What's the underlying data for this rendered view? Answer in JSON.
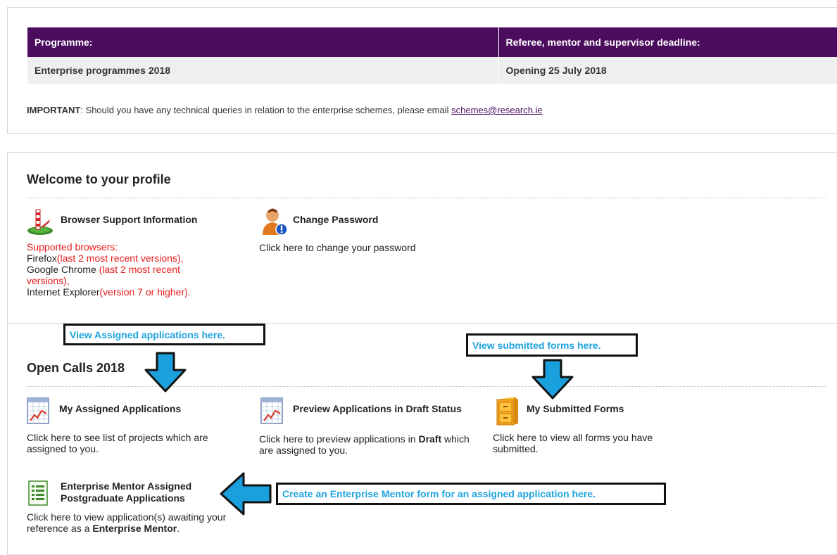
{
  "table": {
    "header_programme": "Programme:",
    "header_deadline": "Referee, mentor and supervisor deadline:",
    "row_programme": "Enterprise programmes 2018",
    "row_deadline": "Opening 25 July 2018"
  },
  "important": {
    "label": "IMPORTANT",
    "text": ": Should you have any technical queries in relation to the enterprise schemes, please email ",
    "email": "schemes@research.ie"
  },
  "welcome": {
    "title": "Welcome to your profile",
    "browser_title": "Browser Support Information",
    "browser_line1": "Supported browsers:",
    "firefox": "Firefox",
    "firefox_note": "(last 2 most recent versions),",
    "chrome": "Google Chrome ",
    "chrome_note": "(last 2 most recent versions),",
    "ie": "Internet Explorer",
    "ie_note": "(version 7 or higher).",
    "password_title": "Change Password",
    "password_desc": "Click here to change your password"
  },
  "open_calls": {
    "title": "Open Calls 2018",
    "assigned_title": "My Assigned Applications",
    "assigned_desc": "Click here to see list of projects which are assigned to you.",
    "preview_title": "Preview Applications in Draft Status",
    "preview_desc_pre": "Click here to preview applications in ",
    "preview_desc_bold": "Draft",
    "preview_desc_post": " which are assigned to you.",
    "submitted_title": "My Submitted Forms",
    "submitted_desc": "Click here to view all forms you have submitted.",
    "mentor_title": "Enterprise Mentor Assigned Postgraduate Applications",
    "mentor_desc_pre": "Click here to view application(s) awaiting your reference as a ",
    "mentor_desc_bold": "Enterprise Mentor",
    "mentor_desc_post": "."
  },
  "callouts": {
    "assigned": "View Assigned applications here.",
    "submitted": "View submitted forms here.",
    "mentor": "Create an Enterprise Mentor form for an assigned application here."
  },
  "colors": {
    "header_purple": "#4b0c5e",
    "callout_text": "#1ea3e0",
    "arrow_fill": "#1aa0dc",
    "supported_red": "#e81c1c"
  }
}
